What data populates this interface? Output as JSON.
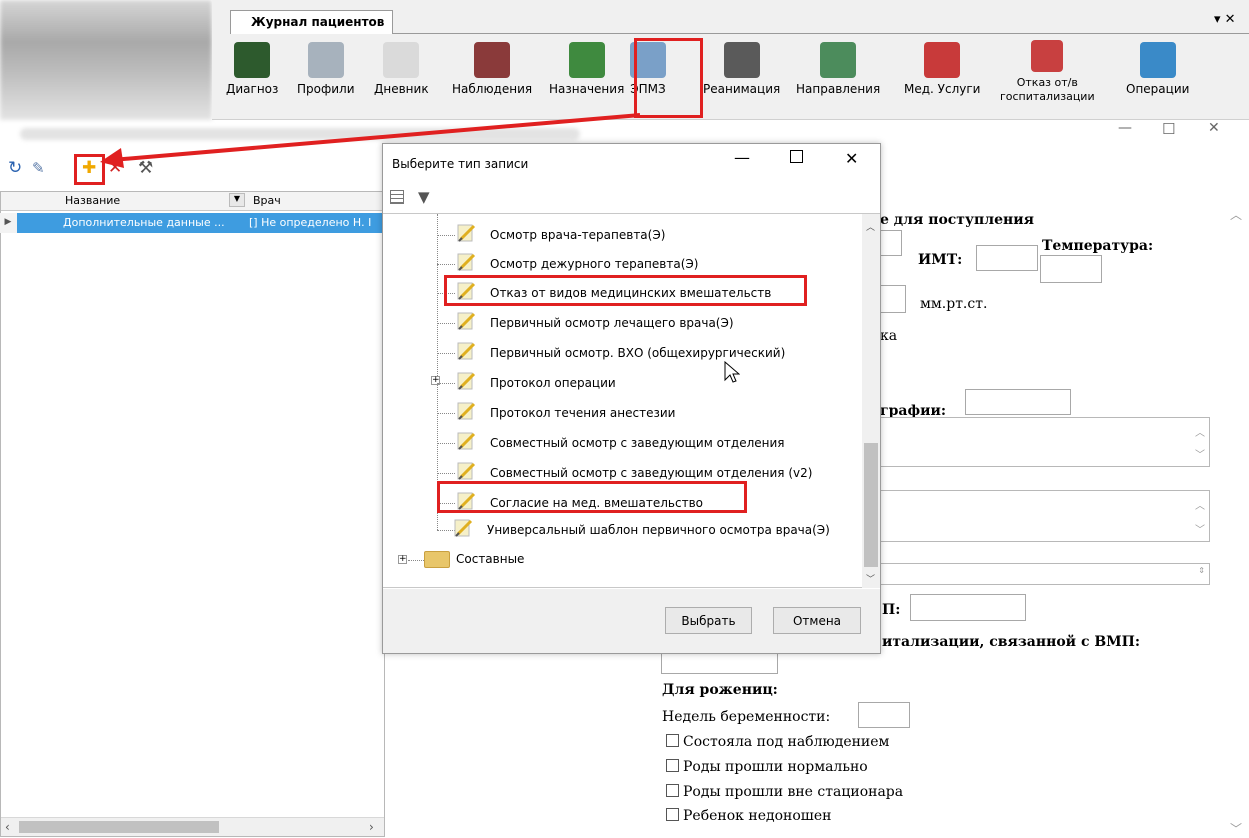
{
  "ribbon": {
    "tab_label": "Журнал пациентов",
    "menu_close": "▾ ✕",
    "buttons": [
      {
        "label": "Диагноз",
        "icon": "mkb-book-icon",
        "color": "#2d5a2d"
      },
      {
        "label": "Профили",
        "icon": "bed-icon",
        "color": "#a7b2bd"
      },
      {
        "label": "Дневник",
        "icon": "notebook-pen-icon",
        "color": "#d8d8d8"
      },
      {
        "label": "Наблюдения",
        "icon": "magnifier-icon",
        "color": "#8a3a3a"
      },
      {
        "label": "Назначения",
        "icon": "pills-icon",
        "color": "#3f8a3f"
      },
      {
        "label": "ЭПМЗ",
        "icon": "document-check-icon",
        "color": "#7aa0c8"
      },
      {
        "label": "Реанимация",
        "icon": "ecg-monitor-icon",
        "color": "#5a5a5a"
      },
      {
        "label": "Направления",
        "icon": "doctor-icon",
        "color": "#4c8c5c"
      },
      {
        "label": "Мед. Услуги",
        "icon": "stethoscope-icon",
        "color": "#c83a3a"
      },
      {
        "label_line1": "Отказ от/в",
        "label_line2": "госпитализации",
        "icon": "doctor-cancel-icon",
        "color": "#c84040"
      },
      {
        "label": "Операции",
        "icon": "operation-icon",
        "color": "#3a8ac8"
      }
    ]
  },
  "left_panel": {
    "toolbar": [
      "refresh-icon",
      "edit-icon",
      "add-icon",
      "delete-icon",
      "tools-icon"
    ],
    "columns": [
      "Название",
      "Врач"
    ],
    "row": {
      "name": "Дополнительные данные ...",
      "doctor": "[] Не определено Н. I"
    }
  },
  "window_controls": {
    "minimize": "—",
    "maximize": "☐",
    "close": "✕"
  },
  "form": {
    "title_part": "е для поступления",
    "imt_label": "ИМТ:",
    "temperature_label": "Температура:",
    "pressure_unit": "мм.рт.ст.",
    "truncated_ka": "ка",
    "photo_label": "графии:",
    "vmp_label": "П:",
    "hospital_vmp_label": "итализации, связанной с ВМП:",
    "women_header": "Для рожениц:",
    "pregnancy_weeks_label": "Недель беременности:",
    "checkboxes": [
      "Состояла под наблюдением",
      "Роды прошли нормально",
      "Роды прошли вне стационара",
      "Ребенок недоношен"
    ]
  },
  "dialog": {
    "title": "Выберите тип записи",
    "minimize": "—",
    "close": "✕",
    "tree_items": [
      "Осмотр врача-терапевта(Э)",
      "Осмотр дежурного терапевта(Э)",
      "Отказ от видов медицинских вмешательств",
      "Первичный осмотр лечащего врача(Э)",
      "Первичный осмотр. ВХО (общехирургический)",
      "Протокол операции",
      "Протокол течения анестезии",
      "Совместный осмотр с заведующим отделения",
      "Совместный осмотр с заведующим отделения (v2)",
      "Согласие на мед. вмешательство",
      "Универсальный шаблон первичного осмотра врача(Э)"
    ],
    "folder_label": "Составные",
    "select_button": "Выбрать",
    "cancel_button": "Отмена"
  },
  "colors": {
    "highlight": "#e02020",
    "selection": "#3e9ce0"
  }
}
